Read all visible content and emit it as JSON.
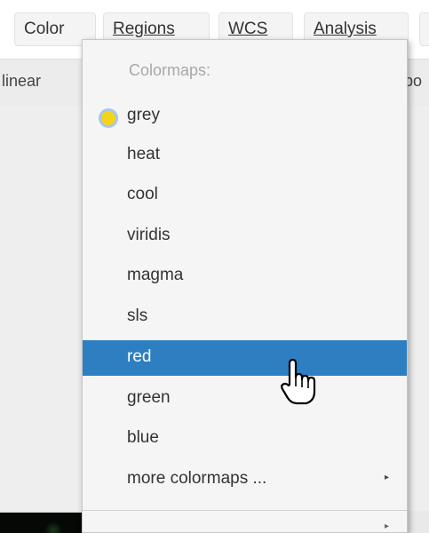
{
  "menubar": {
    "items": [
      {
        "label": "Color"
      },
      {
        "label": "Regions"
      },
      {
        "label": "WCS"
      },
      {
        "label": "Analysis"
      }
    ]
  },
  "toolbar": {
    "left_label": "linear",
    "right_label": "bo"
  },
  "dropdown": {
    "header": "Colormaps:",
    "items": [
      {
        "label": "grey",
        "state": "checked"
      },
      {
        "label": "heat"
      },
      {
        "label": "cool"
      },
      {
        "label": "viridis"
      },
      {
        "label": "magma"
      },
      {
        "label": "sls"
      },
      {
        "label": "red",
        "state": "hovered"
      },
      {
        "label": "green"
      },
      {
        "label": "blue"
      },
      {
        "label": "more colormaps ...",
        "has_submenu": true
      }
    ],
    "selected_color": "#2d7fc1",
    "radio_color": "#f3d41a"
  },
  "icons": {
    "submenu": "chevron-right-icon",
    "cursor": "hand-pointer-icon"
  }
}
